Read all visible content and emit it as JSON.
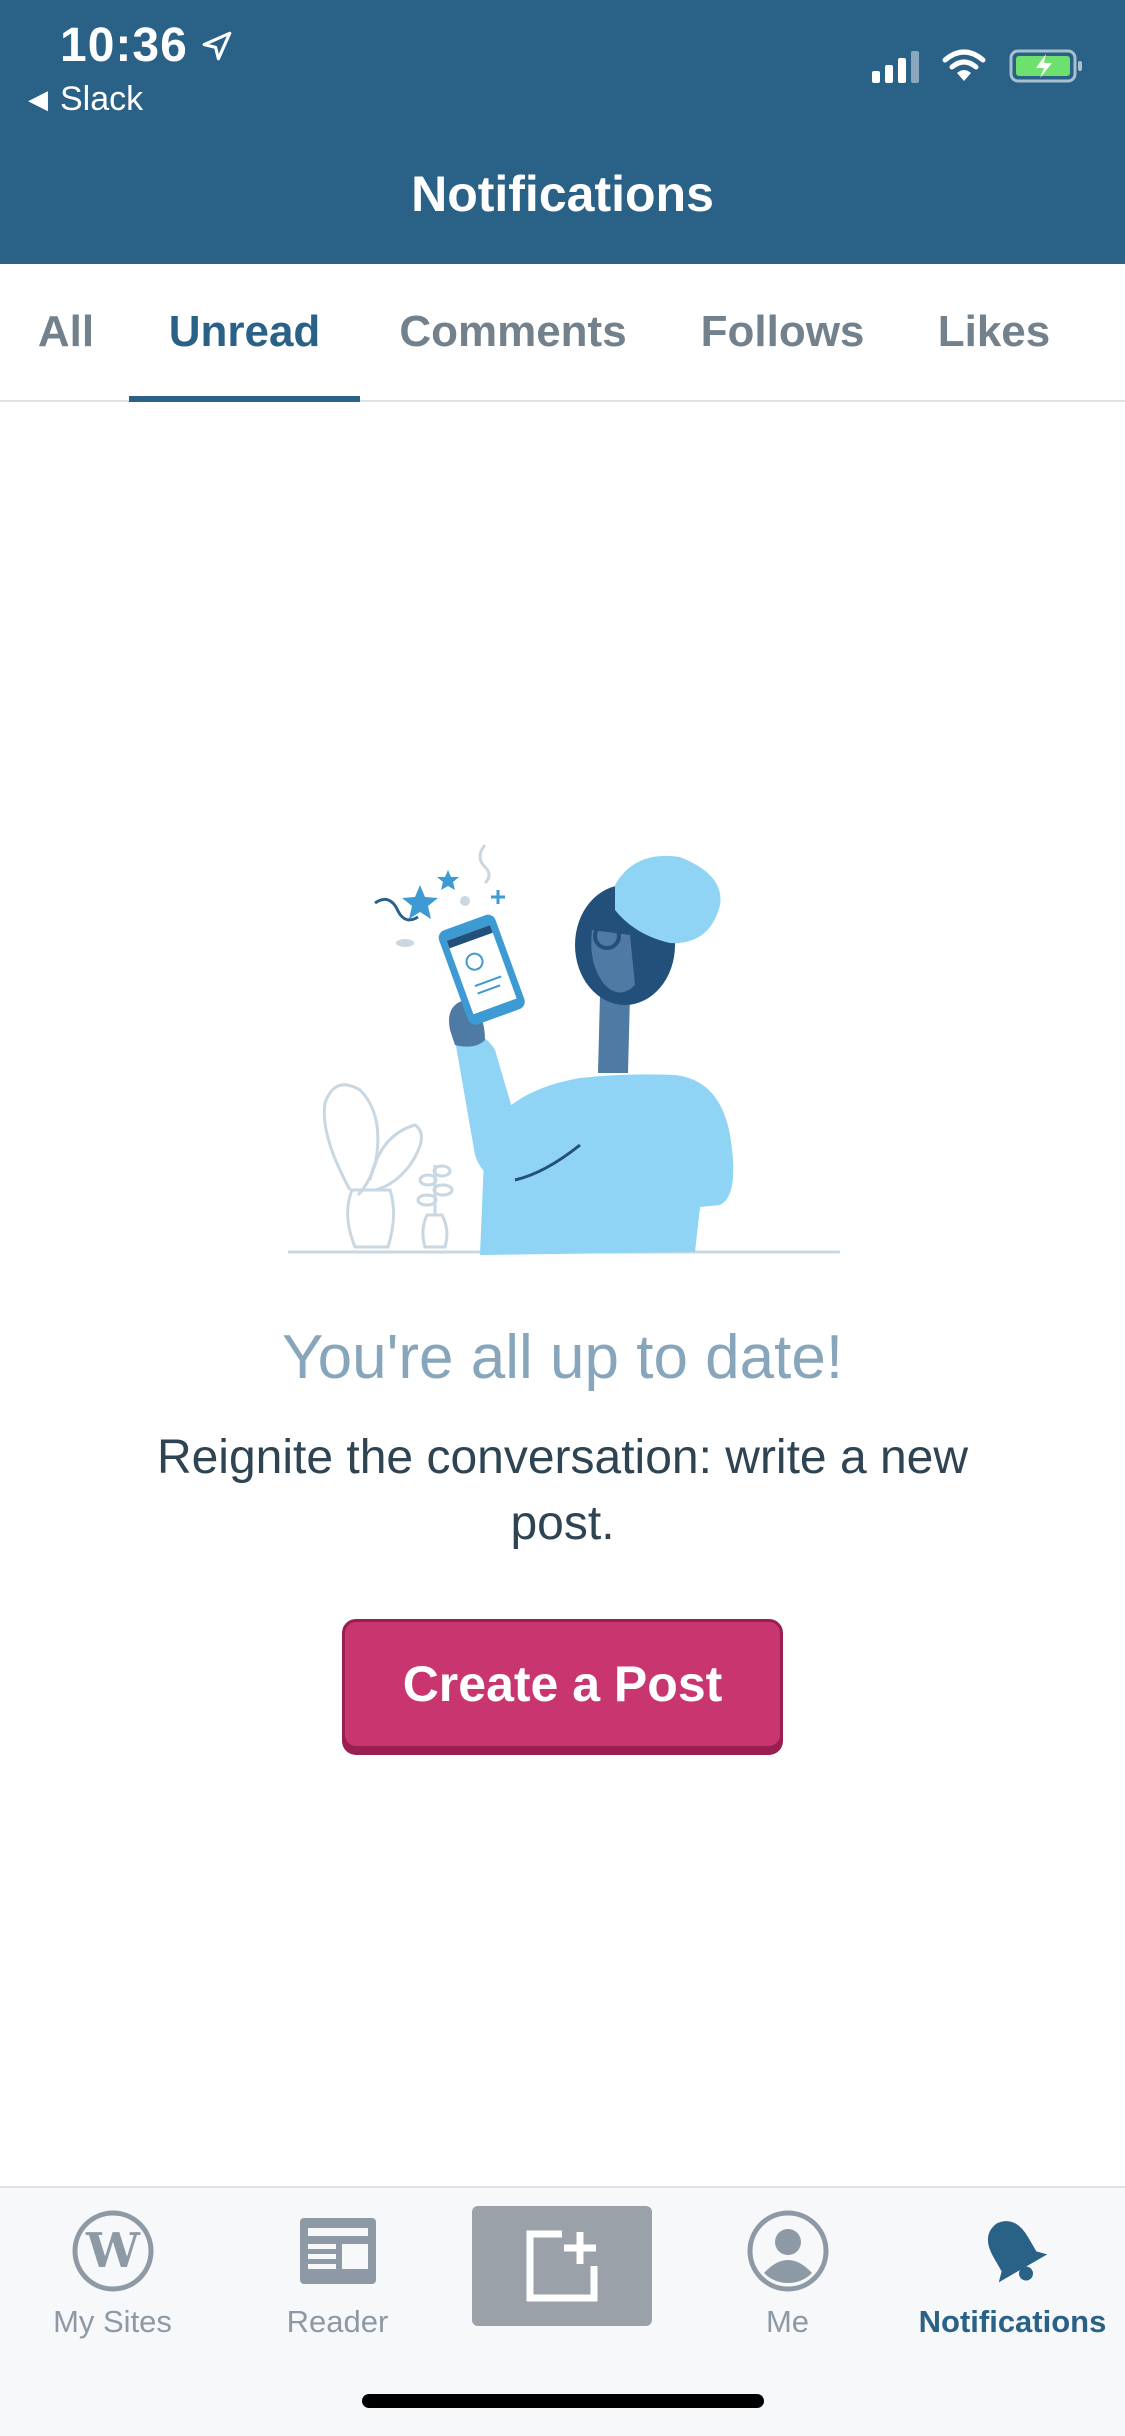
{
  "status_bar": {
    "time": "10:36",
    "back_app": "Slack"
  },
  "header": {
    "title": "Notifications"
  },
  "tabs": [
    {
      "label": "All",
      "active": false
    },
    {
      "label": "Unread",
      "active": true
    },
    {
      "label": "Comments",
      "active": false
    },
    {
      "label": "Follows",
      "active": false
    },
    {
      "label": "Likes",
      "active": false
    }
  ],
  "empty_state": {
    "title": "You're all up to date!",
    "message": "Reignite the conversation: write a new post.",
    "button_label": "Create a Post"
  },
  "tab_bar": {
    "items": [
      {
        "label": "My Sites",
        "icon": "wordpress-icon",
        "active": false
      },
      {
        "label": "Reader",
        "icon": "reader-icon",
        "active": false
      },
      {
        "label": "",
        "icon": "new-post-icon",
        "active": false
      },
      {
        "label": "Me",
        "icon": "profile-icon",
        "active": false
      },
      {
        "label": "Notifications",
        "icon": "bell-icon",
        "active": true
      }
    ]
  },
  "colors": {
    "header": "#2a6187",
    "accent": "#2a6187",
    "cta": "#c9356e",
    "title_text": "#87a6bc",
    "inactive": "#8d9aa5"
  }
}
